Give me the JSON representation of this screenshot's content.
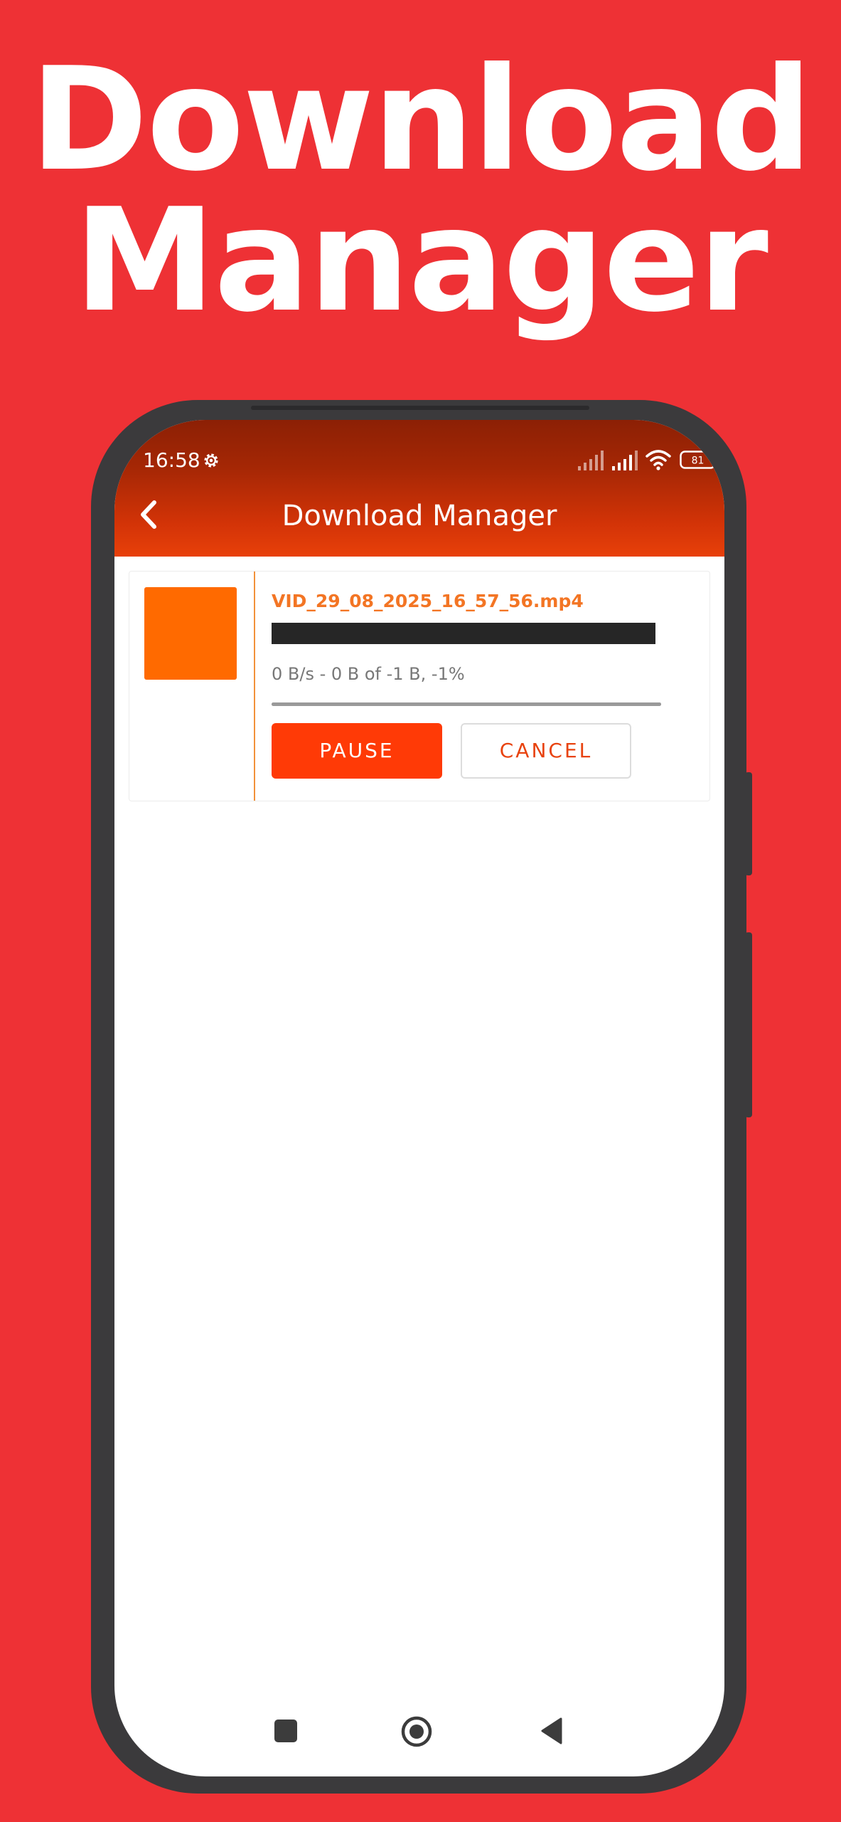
{
  "headline": {
    "line1": "Download",
    "line2": "Manager"
  },
  "colors": {
    "background": "#EE3135",
    "accent": "#FF3A06",
    "filename": "#F37524",
    "thumbnail": "#FF6A00"
  },
  "status_bar": {
    "time": "16:58",
    "battery": "81",
    "icons": [
      "settings-gear-icon",
      "signal-icon",
      "signal-icon",
      "wifi-icon",
      "battery-icon"
    ]
  },
  "app_bar": {
    "back_icon": "chevron-left-icon",
    "title": "Download Manager"
  },
  "download_item": {
    "filename": "VID_29_08_2025_16_57_56.mp4",
    "progress_text": "0 B/s - 0 B of -1 B, -1%",
    "progress_fraction": 1.0,
    "pause_label": "PAUSE",
    "cancel_label": "CANCEL"
  },
  "nav_bar": {
    "icons": [
      "recents-square-icon",
      "home-circle-icon",
      "back-triangle-icon"
    ]
  }
}
